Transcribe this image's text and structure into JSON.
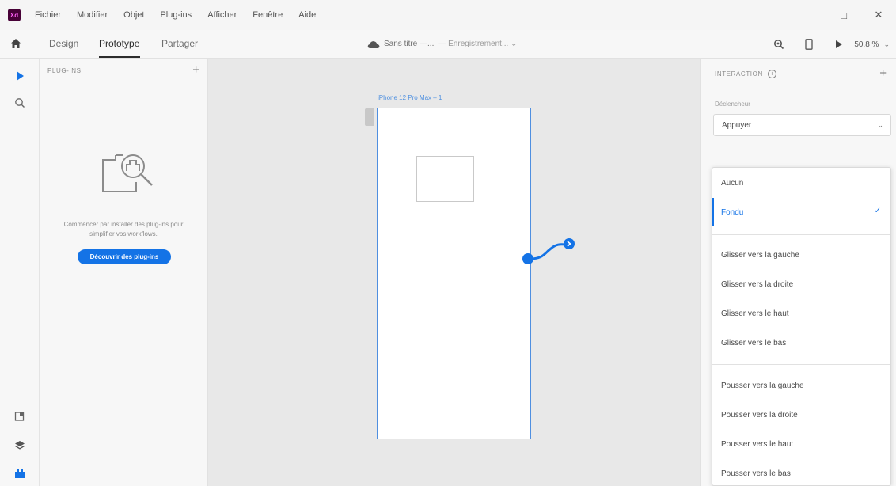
{
  "app": {
    "logo_text": "Xd",
    "menu": [
      "Fichier",
      "Modifier",
      "Objet",
      "Plug-ins",
      "Afficher",
      "Fenêtre",
      "Aide"
    ],
    "window_controls": {
      "maximize": "□",
      "close": "✕"
    }
  },
  "toolbar": {
    "tabs": [
      "Design",
      "Prototype",
      "Partager"
    ],
    "active_tab": "Prototype",
    "doc_title": "Sans titre —...",
    "doc_status": "— Enregistrement... ⌄",
    "zoom": "50.8 %",
    "zoom_chevron": "⌄"
  },
  "plugins_panel": {
    "title": "PLUG-INS",
    "add_label": "+",
    "message": "Commencer par installer des plug-ins pour simplifier vos workflows.",
    "button_label": "Découvrir des plug-ins"
  },
  "canvas": {
    "artboard_label": "iPhone 12 Pro Max – 1"
  },
  "interaction_panel": {
    "title": "INTERACTION",
    "info_label": "i",
    "add_label": "+",
    "trigger_label": "Déclencheur",
    "trigger_value": "Appuyer",
    "chevron": "⌄"
  },
  "transition_dropdown": {
    "selected": "Fondu",
    "check": "✓",
    "items": [
      "Aucun",
      "Fondu",
      "Glisser vers la gauche",
      "Glisser vers la droite",
      "Glisser vers le haut",
      "Glisser vers le bas",
      "Pousser vers la gauche",
      "Pousser vers la droite",
      "Pousser vers le haut",
      "Pousser vers le bas"
    ]
  },
  "colors": {
    "accent": "#1473e6",
    "wire": "#1473e6",
    "artboard_border": "#4f8fe0",
    "xd_logo_bg": "#470137"
  },
  "icons": {
    "home": "home-icon",
    "select_tool": "select-arrow-icon",
    "zoom_tool": "zoom-icon",
    "assets": "assets-icon",
    "layers": "layers-icon",
    "plugins": "plugins-icon",
    "share_preview": "user-icon",
    "device_preview": "device-icon",
    "desktop_preview": "play-icon",
    "cloud": "cloud-icon"
  }
}
